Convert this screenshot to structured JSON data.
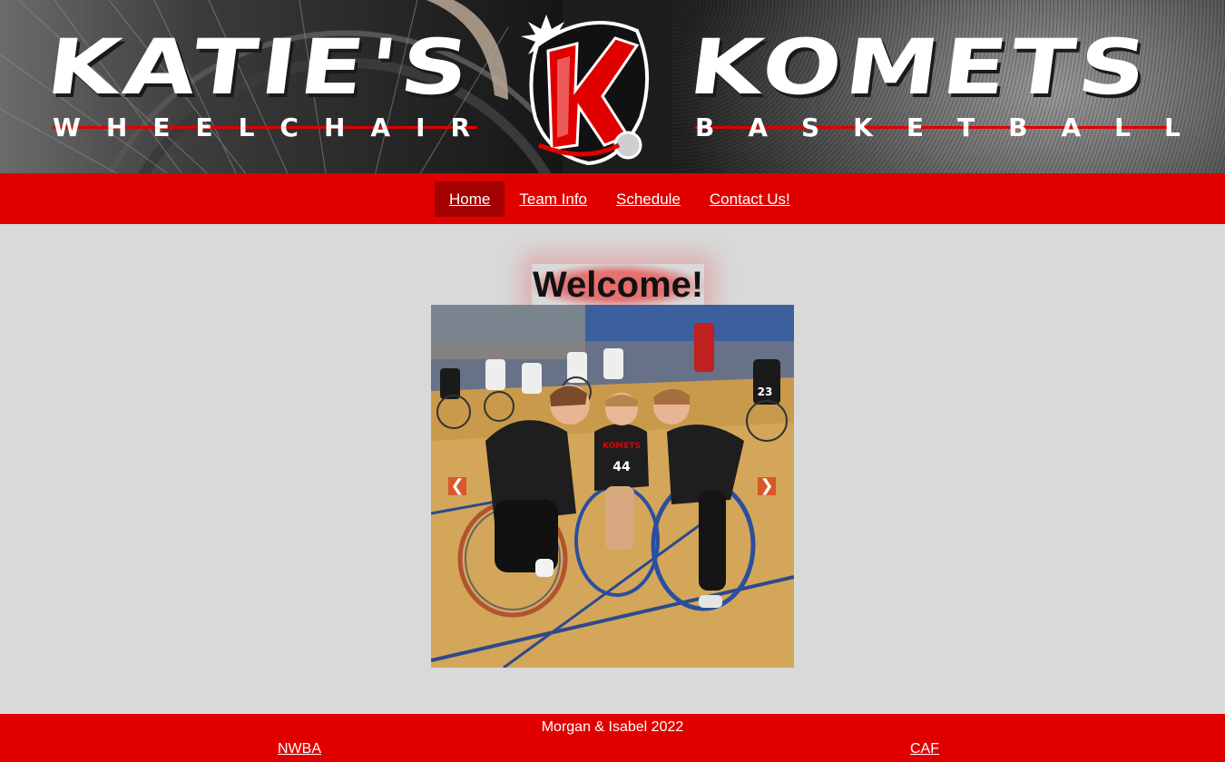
{
  "banner": {
    "title_left": "KATIE'S",
    "subtitle_left": "WHEELCHAIR",
    "title_right": "KOMETS",
    "subtitle_right": "BASKETBALL",
    "logo_icon": "komets-k-logo-icon",
    "accent_color": "#e00000"
  },
  "nav": {
    "items": [
      {
        "label": "Home",
        "active": true
      },
      {
        "label": "Team Info",
        "active": false
      },
      {
        "label": "Schedule",
        "active": false
      },
      {
        "label": "Contact Us!",
        "active": false
      }
    ]
  },
  "main": {
    "heading": "Welcome!",
    "slideshow": {
      "prev_icon": "chevron-left-icon",
      "next_icon": "chevron-right-icon",
      "prev_glyph": "❮",
      "next_glyph": "❯",
      "jersey_numbers": [
        "44",
        "23"
      ],
      "jersey_text": "KOMETS"
    }
  },
  "footer": {
    "credit": "Morgan & Isabel 2022",
    "links": [
      "NWBA",
      "CAF"
    ]
  },
  "colors": {
    "brand_red": "#e00000",
    "active_nav": "#a30000",
    "background": "#d9d9d9"
  }
}
